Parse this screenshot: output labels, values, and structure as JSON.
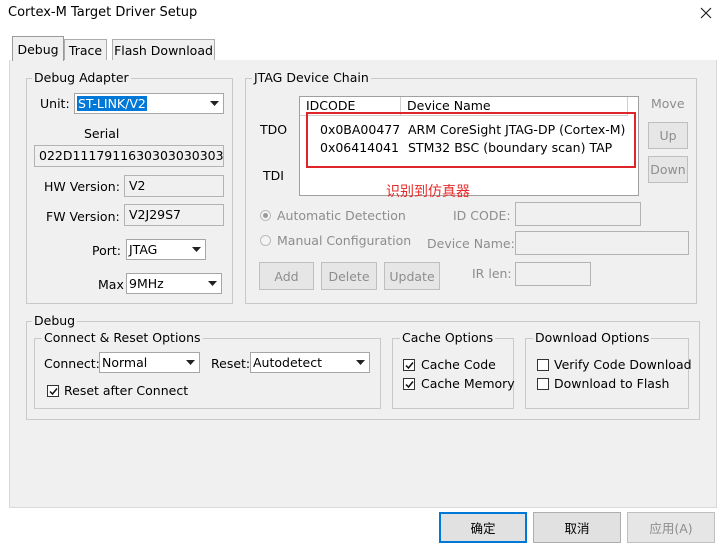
{
  "window": {
    "title": "Cortex-M Target Driver Setup",
    "close_label": "✕"
  },
  "tabs": [
    {
      "label": "Debug",
      "active": true
    },
    {
      "label": "Trace",
      "active": false
    },
    {
      "label": "Flash Download",
      "active": false
    }
  ],
  "debug_adapter": {
    "group_label": "Debug Adapter",
    "unit_label": "Unit:",
    "unit_value": "ST-LINK/V2",
    "serial_label": "Serial",
    "serial_value": "022D11179116303030303032",
    "hw_label": "HW Version:",
    "hw_value": "V2",
    "fw_label": "FW Version:",
    "fw_value": "V2J29S7",
    "port_label": "Port:",
    "port_value": "JTAG",
    "max_label": "Max",
    "max_value": "9MHz"
  },
  "jtag": {
    "group_label": "JTAG Device Chain",
    "tdo_label": "TDO",
    "tdi_label": "TDI",
    "col_idcode": "IDCODE",
    "col_device": "Device Name",
    "rows": [
      {
        "idcode": "0x0BA00477",
        "device": "ARM CoreSight JTAG-DP (Cortex-M)"
      },
      {
        "idcode": "0x06414041",
        "device": "STM32 BSC (boundary scan) TAP"
      }
    ],
    "move_label": "Move",
    "up_label": "Up",
    "down_label": "Down",
    "annotation": "识别到仿真器",
    "auto_detect_label": "Automatic Detection",
    "manual_config_label": "Manual Configuration",
    "id_code_label": "ID CODE:",
    "device_name_label": "Device Name:",
    "ir_len_label": "IR len:",
    "add_label": "Add",
    "delete_label": "Delete",
    "update_label": "Update"
  },
  "debug": {
    "group_label": "Debug",
    "connect_reset": {
      "group_label": "Connect & Reset Options",
      "connect_label": "Connect:",
      "connect_value": "Normal",
      "reset_label": "Reset:",
      "reset_value": "Autodetect",
      "reset_after_connect_label": "Reset after Connect",
      "reset_after_connect_checked": true
    },
    "cache": {
      "group_label": "Cache Options",
      "cache_code_label": "Cache Code",
      "cache_code_checked": true,
      "cache_memory_label": "Cache Memory",
      "cache_memory_checked": true
    },
    "download": {
      "group_label": "Download Options",
      "verify_label": "Verify Code Download",
      "verify_checked": false,
      "flash_label": "Download to Flash",
      "flash_checked": false
    }
  },
  "footer": {
    "ok_label": "确定",
    "cancel_label": "取消",
    "apply_label": "应用(A)"
  },
  "colors": {
    "accent": "#0078d7",
    "annotation": "#ea2a2a"
  },
  "icons": {
    "dropdown": "chevron-down-icon",
    "check": "check-icon",
    "close": "close-icon"
  }
}
